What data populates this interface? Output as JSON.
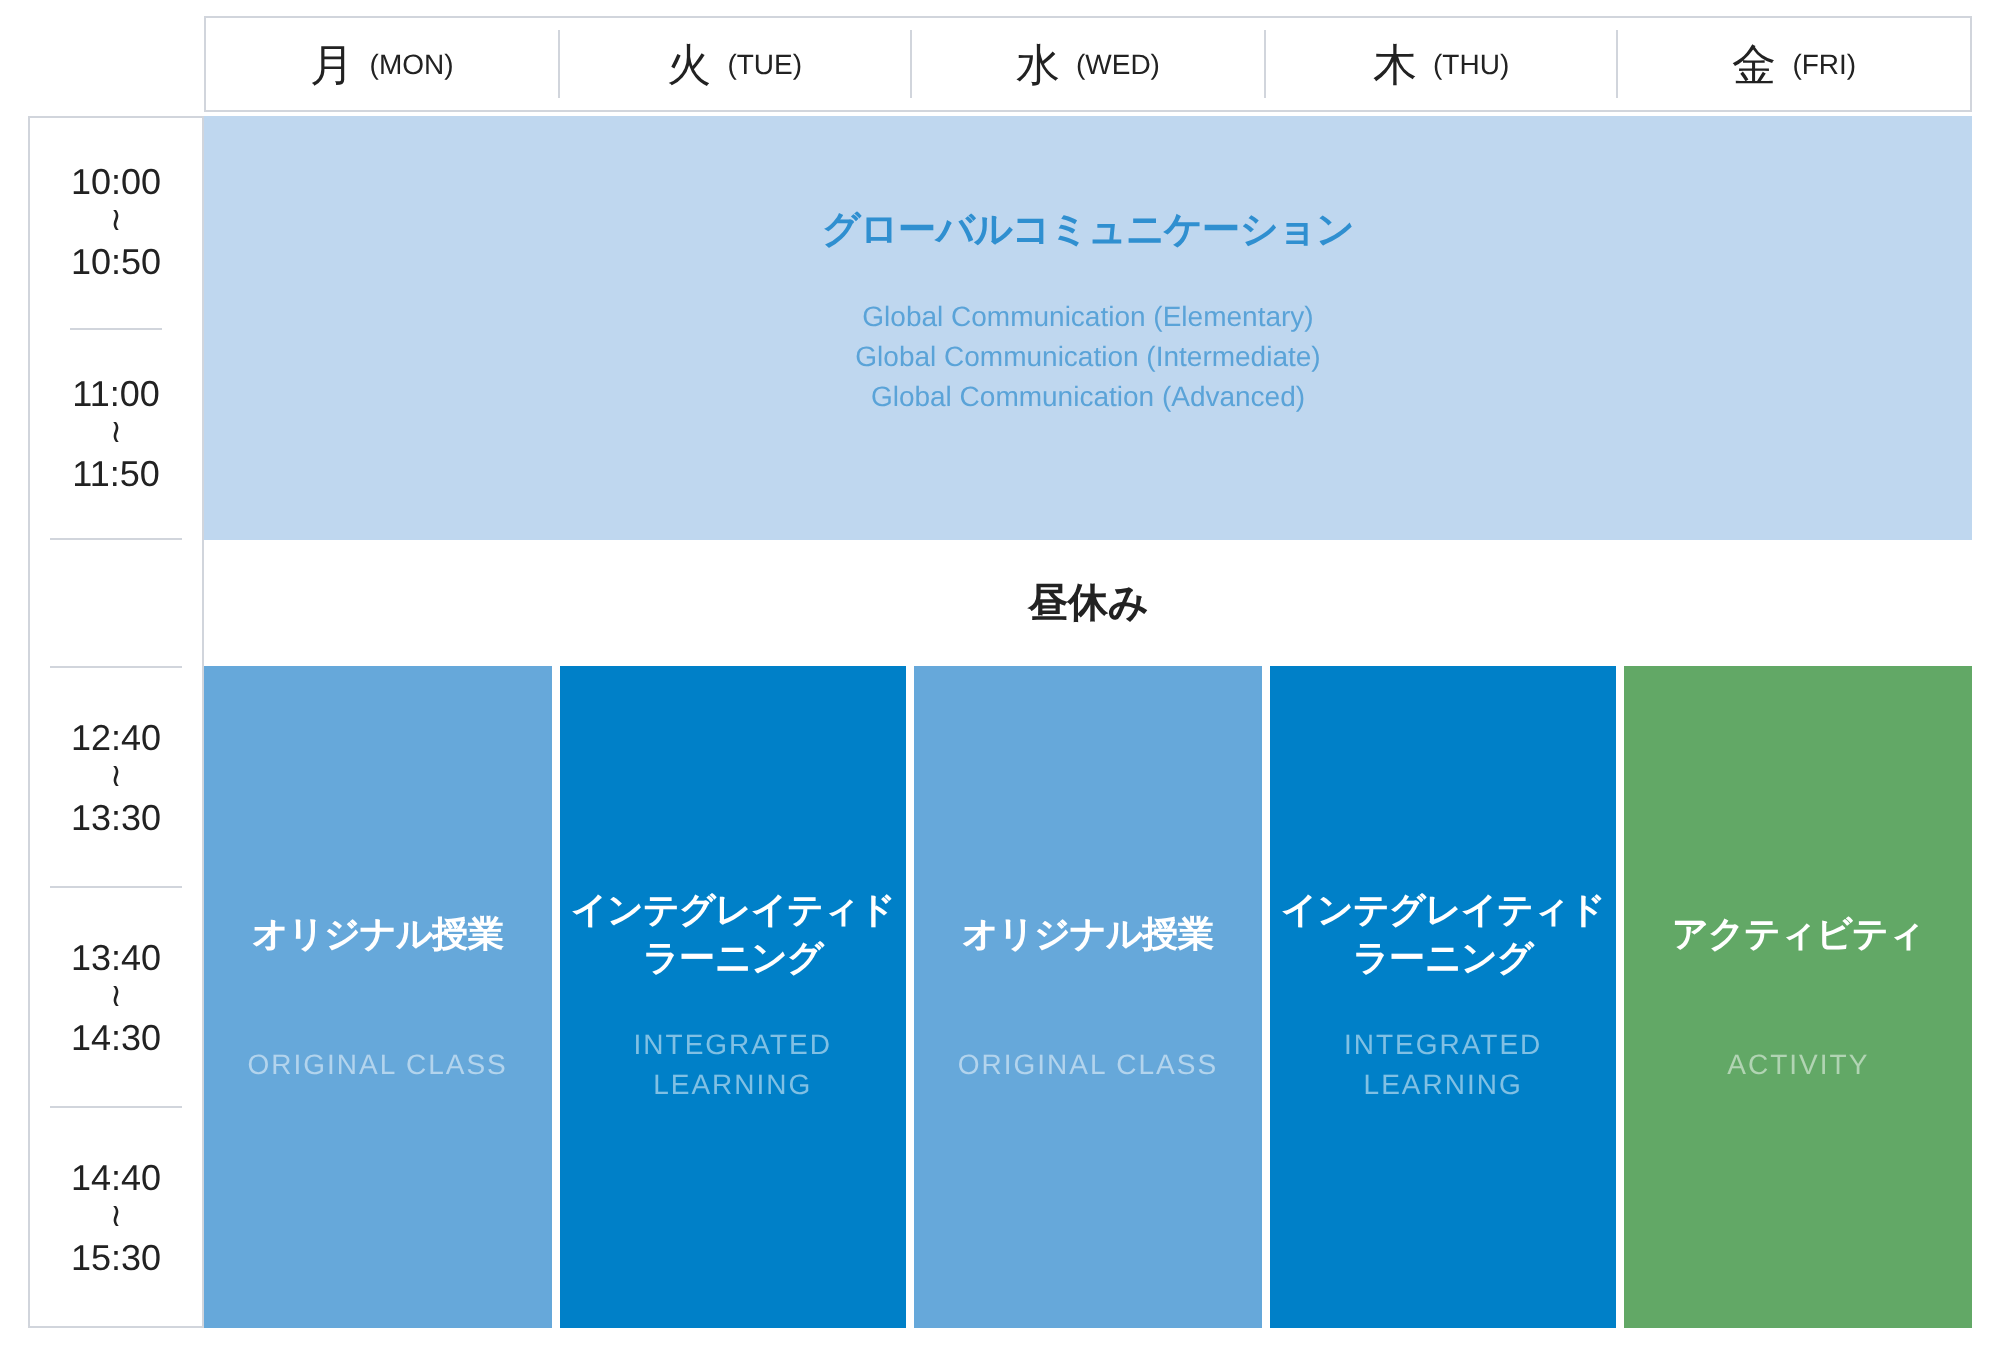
{
  "days": [
    {
      "kanji": "月",
      "en": "(MON)"
    },
    {
      "kanji": "火",
      "en": "(TUE)"
    },
    {
      "kanji": "水",
      "en": "(WED)"
    },
    {
      "kanji": "木",
      "en": "(THU)"
    },
    {
      "kanji": "金",
      "en": "(FRI)"
    }
  ],
  "morning_slots": [
    {
      "start": "10:00",
      "sep": "≀",
      "end": "10:50"
    },
    {
      "start": "11:00",
      "sep": "≀",
      "end": "11:50"
    }
  ],
  "afternoon_slots": [
    {
      "start": "12:40",
      "sep": "≀",
      "end": "13:30"
    },
    {
      "start": "13:40",
      "sep": "≀",
      "end": "14:30"
    },
    {
      "start": "14:40",
      "sep": "≀",
      "end": "15:30"
    }
  ],
  "morning_block": {
    "title": "グローバルコミュニケーション",
    "subtitles": [
      "Global Communication (Elementary)",
      "Global Communication (Intermediate)",
      "Global Communication (Advanced)"
    ]
  },
  "lunch": "昼休み",
  "afternoon_blocks": [
    {
      "title_lines": [
        "オリジナル授業"
      ],
      "subtitle_lines": [
        "ORIGINAL CLASS"
      ],
      "color": "#66a8da"
    },
    {
      "title_lines": [
        "インテグレイティド",
        "ラーニング"
      ],
      "subtitle_lines": [
        "INTEGRATED",
        "LEARNING"
      ],
      "color": "#0080c8"
    },
    {
      "title_lines": [
        "オリジナル授業"
      ],
      "subtitle_lines": [
        "ORIGINAL CLASS"
      ],
      "color": "#66a8da"
    },
    {
      "title_lines": [
        "インテグレイティド",
        "ラーニング"
      ],
      "subtitle_lines": [
        "INTEGRATED",
        "LEARNING"
      ],
      "color": "#0080c8"
    },
    {
      "title_lines": [
        "アクティビティ"
      ],
      "subtitle_lines": [
        "ACTIVITY"
      ],
      "color": "#62a866"
    }
  ]
}
